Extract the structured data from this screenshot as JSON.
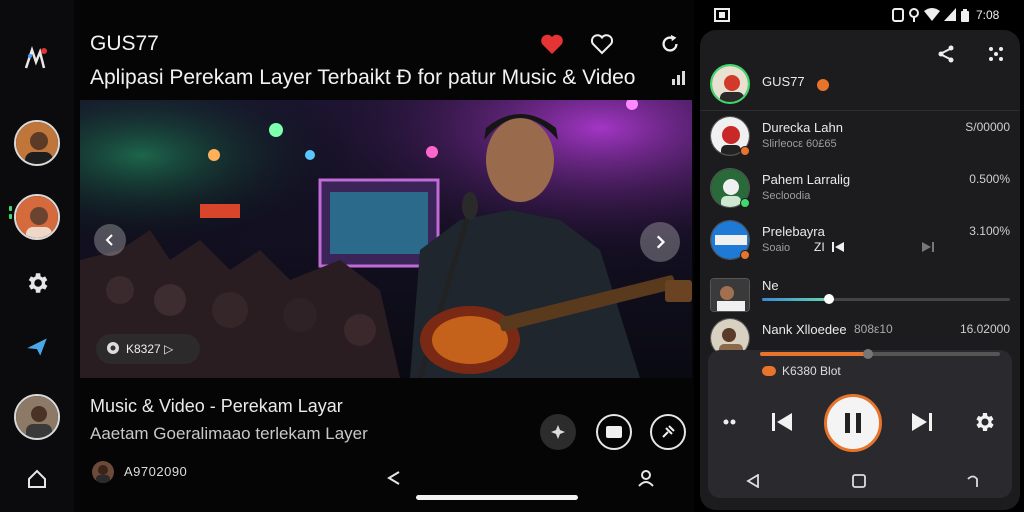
{
  "header": {
    "username": "GUS77",
    "title": "Aplipasi Perekam Layer Terbaikt Đ for patur Music & Video"
  },
  "video": {
    "pill_label": "K8327 ▷"
  },
  "info": {
    "title": "Music & Video - Perekam Layar",
    "description": "Aaetam Goeralimaao terlekam Layer",
    "count": "A9702090"
  },
  "status_bar": {
    "time": "7:08"
  },
  "panel": {
    "username": "GUS77",
    "items": [
      {
        "name": "Durecka Lahn",
        "sub": "Slirleocε 60£65",
        "value": "S/00000"
      },
      {
        "name": "Pahem Larralig",
        "sub": "Secloodia",
        "value": "0.500%"
      },
      {
        "name": "Prelebayra",
        "sub": "Soaio",
        "value": "3.100%",
        "extra": "ZI"
      },
      {
        "name": "Ne",
        "sub": "",
        "value": ""
      },
      {
        "name": "Nank Xlloedee",
        "sub": "",
        "value": "16.02000",
        "mid": "808ε10"
      }
    ],
    "now_playing_label": "K6380 Blot",
    "progress_top": 0.27,
    "progress_bottom": 0.45
  },
  "colors": {
    "accent_orange": "#e8732a",
    "heart_red": "#e63333",
    "panel_bg": "#1c1c1f"
  },
  "icons": {
    "rail": [
      "app-logo",
      "gear-icon",
      "send-icon",
      "home-icon"
    ],
    "top": [
      "heart-filled-icon",
      "heart-outline-icon",
      "refresh-icon",
      "signal-icon"
    ],
    "panel_top": [
      "share-icon",
      "more-icon"
    ],
    "player": [
      "more-dots-icon",
      "previous-icon",
      "pause-icon",
      "next-icon",
      "settings-icon"
    ],
    "nav": [
      "back-icon",
      "home-square-icon",
      "recent-icon"
    ]
  }
}
